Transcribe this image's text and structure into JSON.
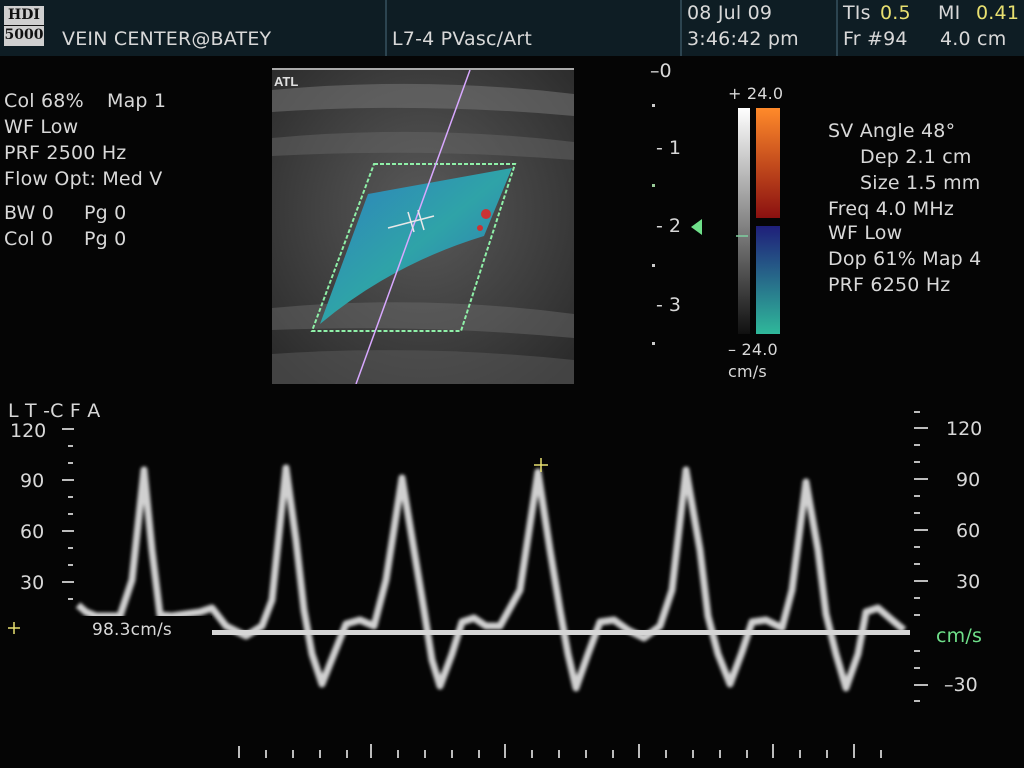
{
  "header": {
    "logo_top": "HDI",
    "logo_bottom": "5000",
    "institution": "VEIN CENTER@BATEY",
    "transducer": "L7-4 PVasc/Art",
    "date": "08 Jul 09",
    "time": "3:46:42 pm",
    "tis_label": "TIs",
    "tis_value": "0.5",
    "mi_label": "MI",
    "mi_value": "0.41",
    "frame": "Fr #94",
    "depth": "4.0 cm"
  },
  "left_params": {
    "col": "Col 68%",
    "map": "Map 1",
    "wf": "WF Low",
    "prf": "PRF 2500  Hz",
    "flow_opt": "Flow Opt: Med V",
    "bw0": "BW 0",
    "pg0a": "Pg 0",
    "col0": "Col 0",
    "pg0b": "Pg 0"
  },
  "image": {
    "atl_label": "ATL",
    "depth_marks": [
      "–0",
      "- 1",
      "- 2",
      "- 3"
    ]
  },
  "color_bar": {
    "top": "+ 24.0",
    "bottom": "– 24.0",
    "unit": "cm/s",
    "top_color": "#ff7a1a",
    "bottom_color": "#2aa88a"
  },
  "right_params": {
    "sv_angle": "SV Angle 48°",
    "dep": "Dep 2.1  cm",
    "size": "Size 1.5  mm",
    "freq": "Freq 4.0  MHz",
    "wf": "WF Low",
    "dop": "Dop 61%  Map 4",
    "prf": "PRF 6250  Hz"
  },
  "spectral": {
    "label": "L T   -C F A",
    "left_scale": [
      "120",
      "90",
      "60",
      "30"
    ],
    "right_scale": [
      "120",
      "90",
      "60",
      "30",
      "–30"
    ],
    "unit": "cm/s",
    "measurement": "98.3cm/s"
  }
}
